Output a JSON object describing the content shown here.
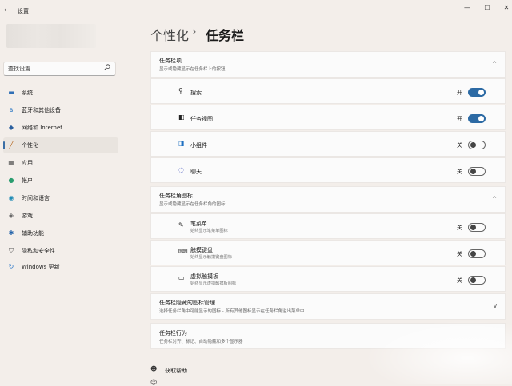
{
  "window": {
    "title": "设置",
    "min": "—",
    "max": "☐",
    "close": "✕"
  },
  "search": {
    "placeholder": "查找设置"
  },
  "sidebar": {
    "items": [
      {
        "label": "系统",
        "icon": "monitor-icon"
      },
      {
        "label": "蓝牙和其他设备",
        "icon": "bluetooth-icon"
      },
      {
        "label": "网络和 Internet",
        "icon": "wifi-icon"
      },
      {
        "label": "个性化",
        "icon": "brush-icon",
        "active": true
      },
      {
        "label": "应用",
        "icon": "apps-icon"
      },
      {
        "label": "帐户",
        "icon": "person-icon"
      },
      {
        "label": "时间和语言",
        "icon": "globe-icon"
      },
      {
        "label": "游戏",
        "icon": "gamepad-icon"
      },
      {
        "label": "辅助功能",
        "icon": "accessibility-icon"
      },
      {
        "label": "隐私和安全性",
        "icon": "shield-icon"
      },
      {
        "label": "Windows 更新",
        "icon": "update-icon"
      }
    ]
  },
  "breadcrumb": {
    "parent": "个性化",
    "separator": "›",
    "current": "任务栏"
  },
  "sections": {
    "taskbar_items": {
      "title": "任务栏项",
      "desc": "显示或隐藏显示在任务栏上的按钮",
      "chevron": "^",
      "rows": [
        {
          "label": "搜索",
          "state": "开",
          "on": true,
          "icon": "search-icon"
        },
        {
          "label": "任务视图",
          "state": "开",
          "on": true,
          "icon": "task-view-icon"
        },
        {
          "label": "小组件",
          "state": "关",
          "on": false,
          "icon": "widgets-icon"
        },
        {
          "label": "聊天",
          "state": "关",
          "on": false,
          "icon": "chat-icon"
        }
      ]
    },
    "corner_icons": {
      "title": "任务栏角图标",
      "desc": "显示或隐藏显示在任务栏角的图标",
      "chevron": "^",
      "rows": [
        {
          "label": "笔菜单",
          "sub": "始终显示笔菜单图标",
          "state": "关",
          "on": false,
          "icon": "pen-icon"
        },
        {
          "label": "触摸键盘",
          "sub": "始终显示触摸键盘图标",
          "state": "关",
          "on": false,
          "icon": "keyboard-icon"
        },
        {
          "label": "虚拟触摸板",
          "sub": "始终显示虚拟触摸板图标",
          "state": "关",
          "on": false,
          "icon": "touchpad-icon"
        }
      ]
    },
    "overflow": {
      "title": "任务栏隐藏的图标管理",
      "desc": "选择任务栏角中可能显示的图标 - 所有其他图标显示在任务栏角溢出菜单中",
      "chevron": "v"
    },
    "behaviors": {
      "title": "任务栏行为",
      "desc": "任务栏对齐、标记、自动隐藏和多个显示器"
    }
  },
  "footer": {
    "help": "获取帮助"
  }
}
